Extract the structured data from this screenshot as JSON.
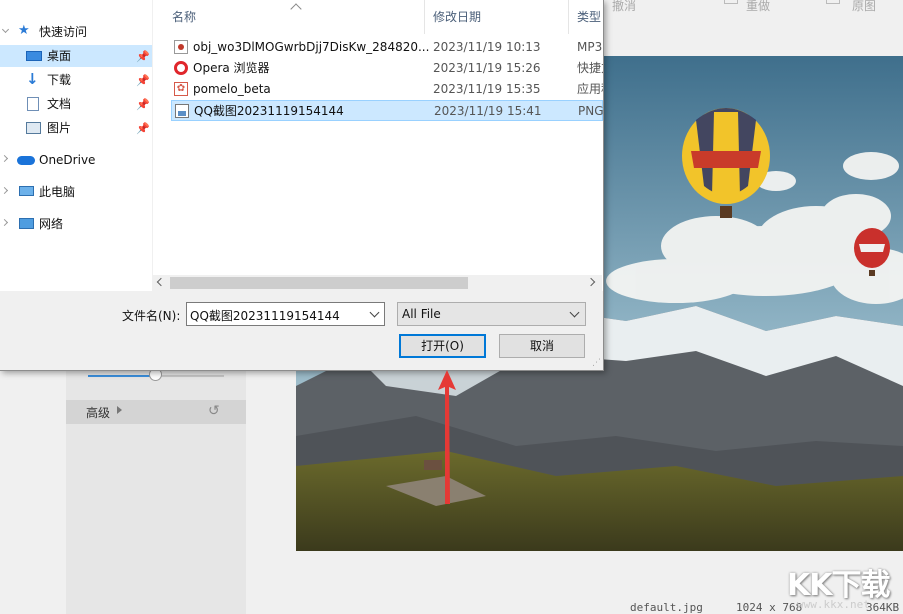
{
  "background_app": {
    "top_items": [
      "撤消",
      "重做",
      "原图"
    ],
    "advanced_label": "高级",
    "reset_icon": "refresh-icon",
    "slider_value": 0.5,
    "status": {
      "filename": "default.jpg",
      "dimensions": "1024 x 768",
      "size": "364KB"
    },
    "watermark": "KK下载",
    "watermark_url": "www.kkx.net"
  },
  "dialog": {
    "nav": {
      "quick_access": "快速访问",
      "items": [
        {
          "label": "桌面",
          "icon": "desktop-icon",
          "pinned": true,
          "selected": true
        },
        {
          "label": "下载",
          "icon": "download-arrow-icon",
          "pinned": true,
          "selected": false
        },
        {
          "label": "文档",
          "icon": "document-icon",
          "pinned": true,
          "selected": false
        },
        {
          "label": "图片",
          "icon": "picture-icon",
          "pinned": true,
          "selected": false
        }
      ],
      "onedrive": "OneDrive",
      "this_pc": "此电脑",
      "network": "网络"
    },
    "columns": {
      "name": "名称",
      "date": "修改日期",
      "type": "类型"
    },
    "files": [
      {
        "name": "obj_wo3DlMOGwrbDjj7DisKw_284820...",
        "date": "2023/11/19 10:13",
        "type": "MP3",
        "icon": "audio-file-icon",
        "selected": false
      },
      {
        "name": "Opera 浏览器",
        "date": "2023/11/19 15:26",
        "type": "快捷方式",
        "icon": "opera-icon",
        "selected": false
      },
      {
        "name": "pomelo_beta",
        "date": "2023/11/19 15:35",
        "type": "应用程序",
        "icon": "app-gear-icon",
        "selected": false
      },
      {
        "name": "QQ截图20231119154144",
        "date": "2023/11/19 15:41",
        "type": "PNG",
        "icon": "image-file-icon",
        "selected": true
      }
    ],
    "filename_label": "文件名(N):",
    "filename_value": "QQ截图20231119154144",
    "filetype_value": "All File",
    "open_button": "打开(O)",
    "cancel_button": "取消"
  },
  "colors": {
    "selection": "#cce8ff",
    "accent": "#0078d7",
    "annotation_arrow": "#e53935"
  }
}
